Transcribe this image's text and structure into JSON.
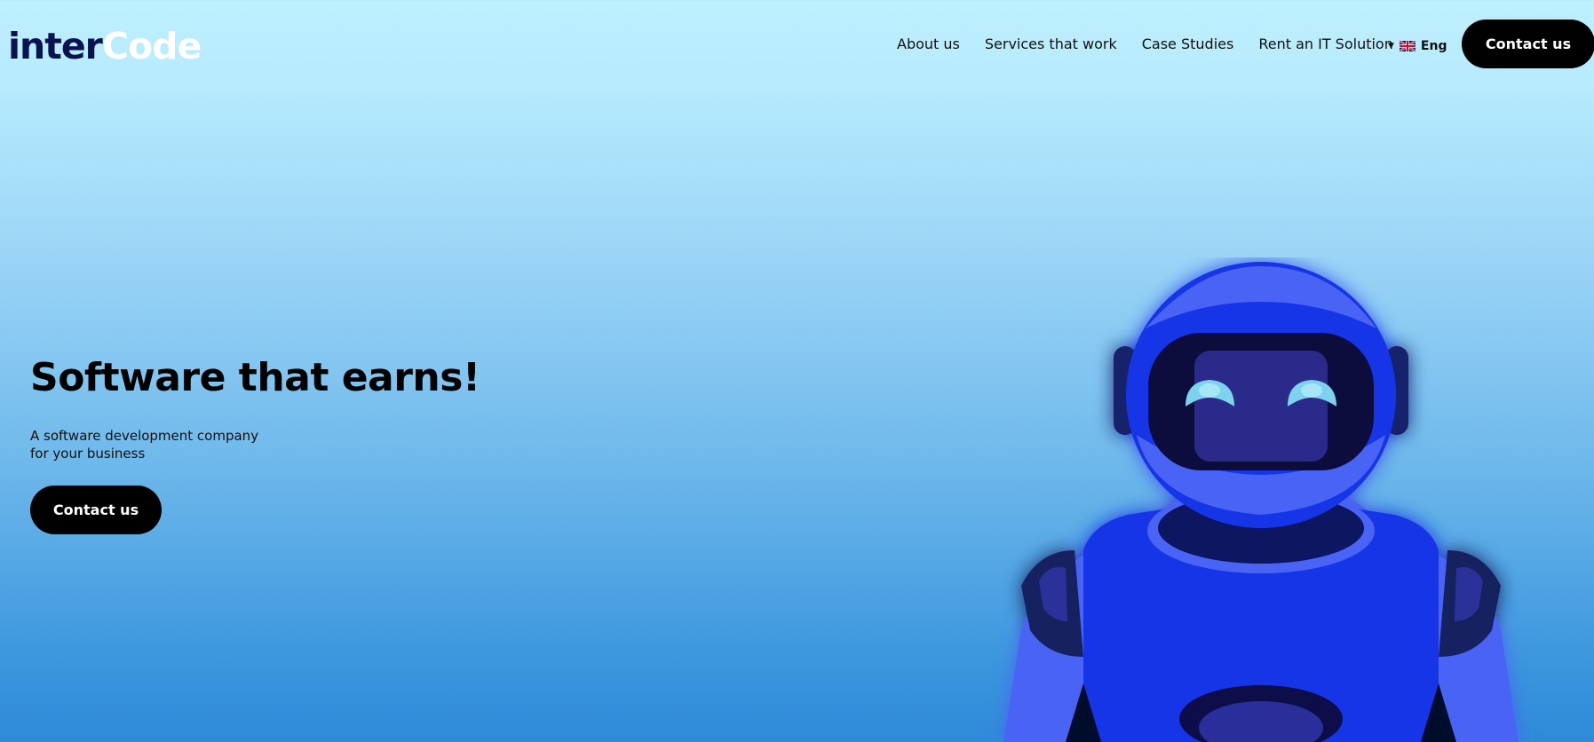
{
  "header": {
    "logo": {
      "part1": "inter",
      "part2": "Code"
    },
    "nav": [
      "About us",
      "Services that work",
      "Case Studies",
      "Rent an IT Solution"
    ],
    "language": {
      "label": "Eng",
      "icon": "uk-flag-icon"
    },
    "contact_label": "Contact us"
  },
  "hero": {
    "title": "Software that earns!",
    "subtitle_line1": "A software development company",
    "subtitle_line2": "for your business",
    "contact_label": "Contact us"
  },
  "colors": {
    "logo_dark": "#0c1150",
    "logo_light": "#ffffff",
    "button_bg": "#000000",
    "robot_blue": "#1836e6"
  }
}
